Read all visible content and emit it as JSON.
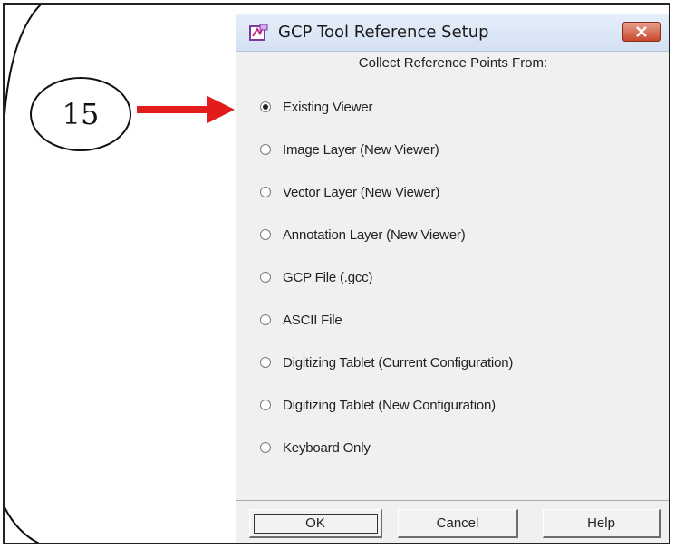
{
  "callout": {
    "number": "15"
  },
  "dialog": {
    "title": "GCP Tool Reference Setup",
    "app_icon": "viewer-app-icon",
    "close_icon": "close-x-icon",
    "prompt": "Collect Reference Points From:",
    "options": [
      {
        "label": "Existing Viewer",
        "selected": true
      },
      {
        "label": "Image Layer (New Viewer)",
        "selected": false
      },
      {
        "label": "Vector Layer (New Viewer)",
        "selected": false
      },
      {
        "label": "Annotation Layer (New Viewer)",
        "selected": false
      },
      {
        "label": "GCP File (.gcc)",
        "selected": false
      },
      {
        "label": "ASCII File",
        "selected": false
      },
      {
        "label": "Digitizing Tablet (Current Configuration)",
        "selected": false
      },
      {
        "label": "Digitizing Tablet (New Configuration)",
        "selected": false
      },
      {
        "label": "Keyboard Only",
        "selected": false
      }
    ],
    "buttons": {
      "ok": "OK",
      "cancel": "Cancel",
      "help": "Help"
    }
  },
  "colors": {
    "arrow": "#e21b1b",
    "close_button": "#c9472c"
  }
}
